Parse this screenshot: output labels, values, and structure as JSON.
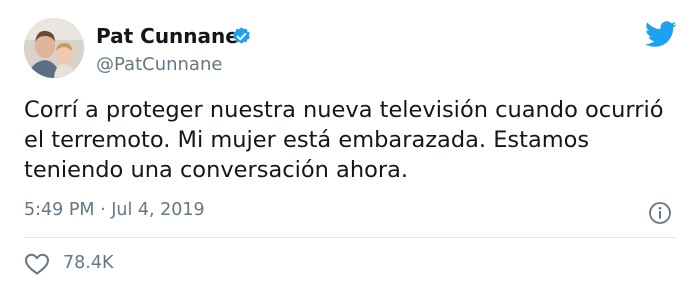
{
  "author": {
    "name": "Pat Cunnane",
    "handle": "@PatCunnane",
    "verified": true
  },
  "tweet": {
    "lines": [
      "Corrí a proteger nuestra nueva televisión cuando ocurrió",
      "el terremoto. Mi mujer está embarazada. Estamos",
      "teniendo una conversación ahora."
    ]
  },
  "meta": {
    "timestamp": "5:49 PM · Jul 4, 2019"
  },
  "stats": {
    "likes": "78.4K"
  },
  "icons": {
    "brand": "twitter-bird-icon",
    "verified": "verified-badge-icon",
    "info": "info-icon",
    "like": "heart-icon"
  },
  "colors": {
    "brand_blue": "#1da1f2",
    "secondary_text": "#657786",
    "primary_text": "#14171a",
    "divider": "#e1e8ed"
  }
}
